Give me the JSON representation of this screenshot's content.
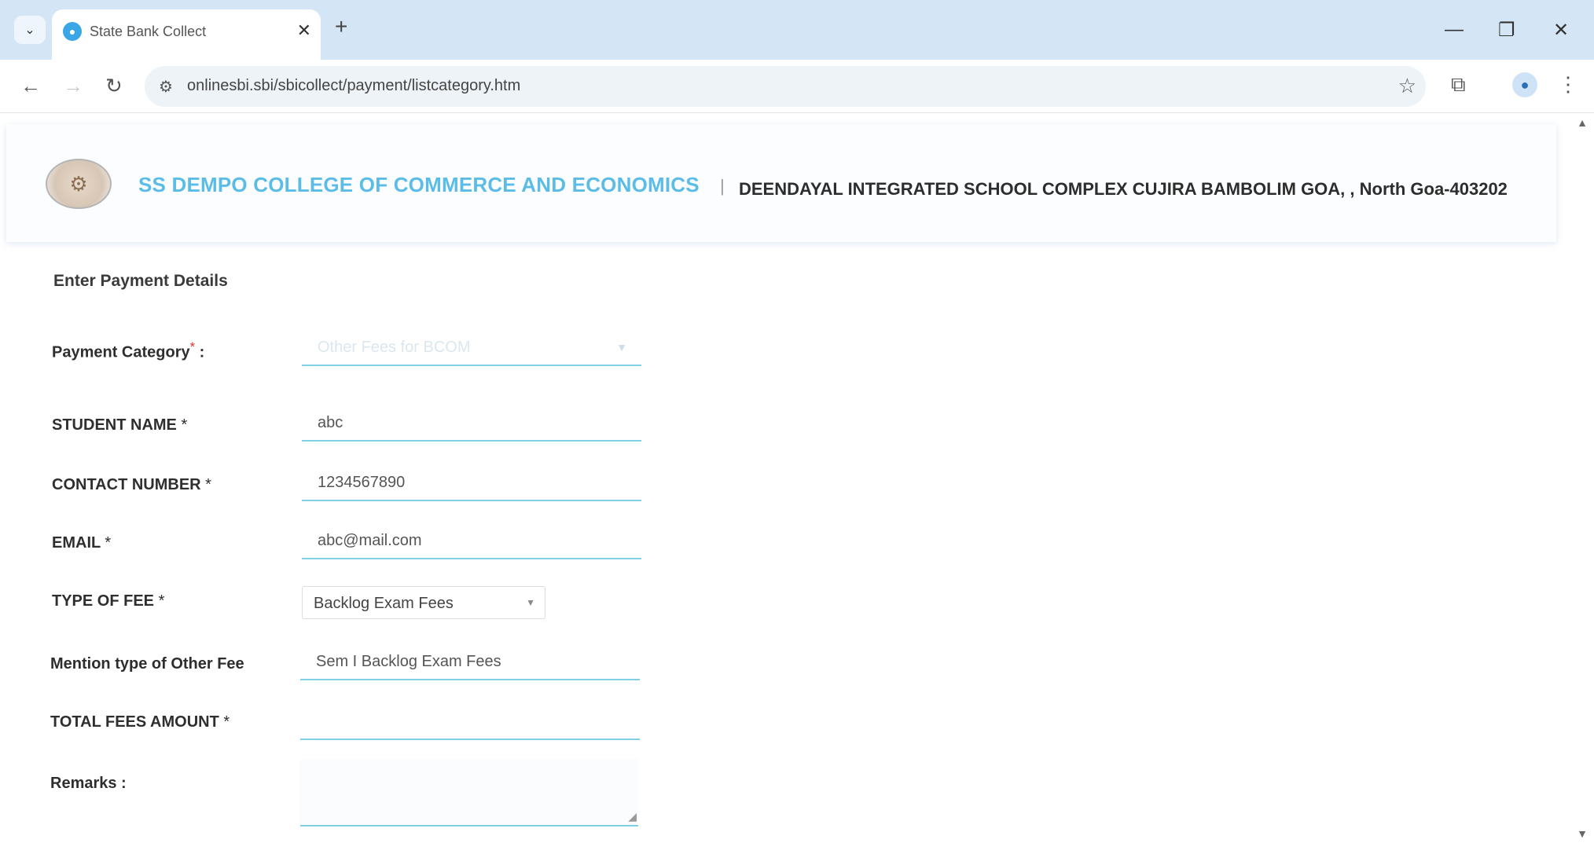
{
  "browser": {
    "tab_title": "State Bank Collect",
    "url": "onlinesbi.sbi/sbicollect/payment/listcategory.htm"
  },
  "header": {
    "college_name": "SS DEMPO COLLEGE OF COMMERCE AND ECONOMICS",
    "separator": "|",
    "address": "DEENDAYAL INTEGRATED SCHOOL COMPLEX CUJIRA BAMBOLIM GOA, , North Goa-403202"
  },
  "form": {
    "section_title": "Enter Payment Details",
    "payment_category": {
      "label": "Payment Category",
      "colon": " :",
      "value": "Other Fees for BCOM"
    },
    "student_name": {
      "label": "STUDENT NAME ",
      "value": "abc"
    },
    "contact_number": {
      "label": "CONTACT NUMBER ",
      "value": "1234567890"
    },
    "email": {
      "label": "EMAIL ",
      "value": "abc@mail.com"
    },
    "type_of_fee": {
      "label": "TYPE OF FEE ",
      "value": "Backlog Exam Fees"
    },
    "other_fee_type": {
      "label": "Mention type of Other Fee",
      "value": "Sem I Backlog Exam Fees"
    },
    "total_fees_amount": {
      "label": "TOTAL FEES AMOUNT ",
      "value": ""
    },
    "remarks": {
      "label": "Remarks :"
    },
    "required_mark": "*"
  }
}
